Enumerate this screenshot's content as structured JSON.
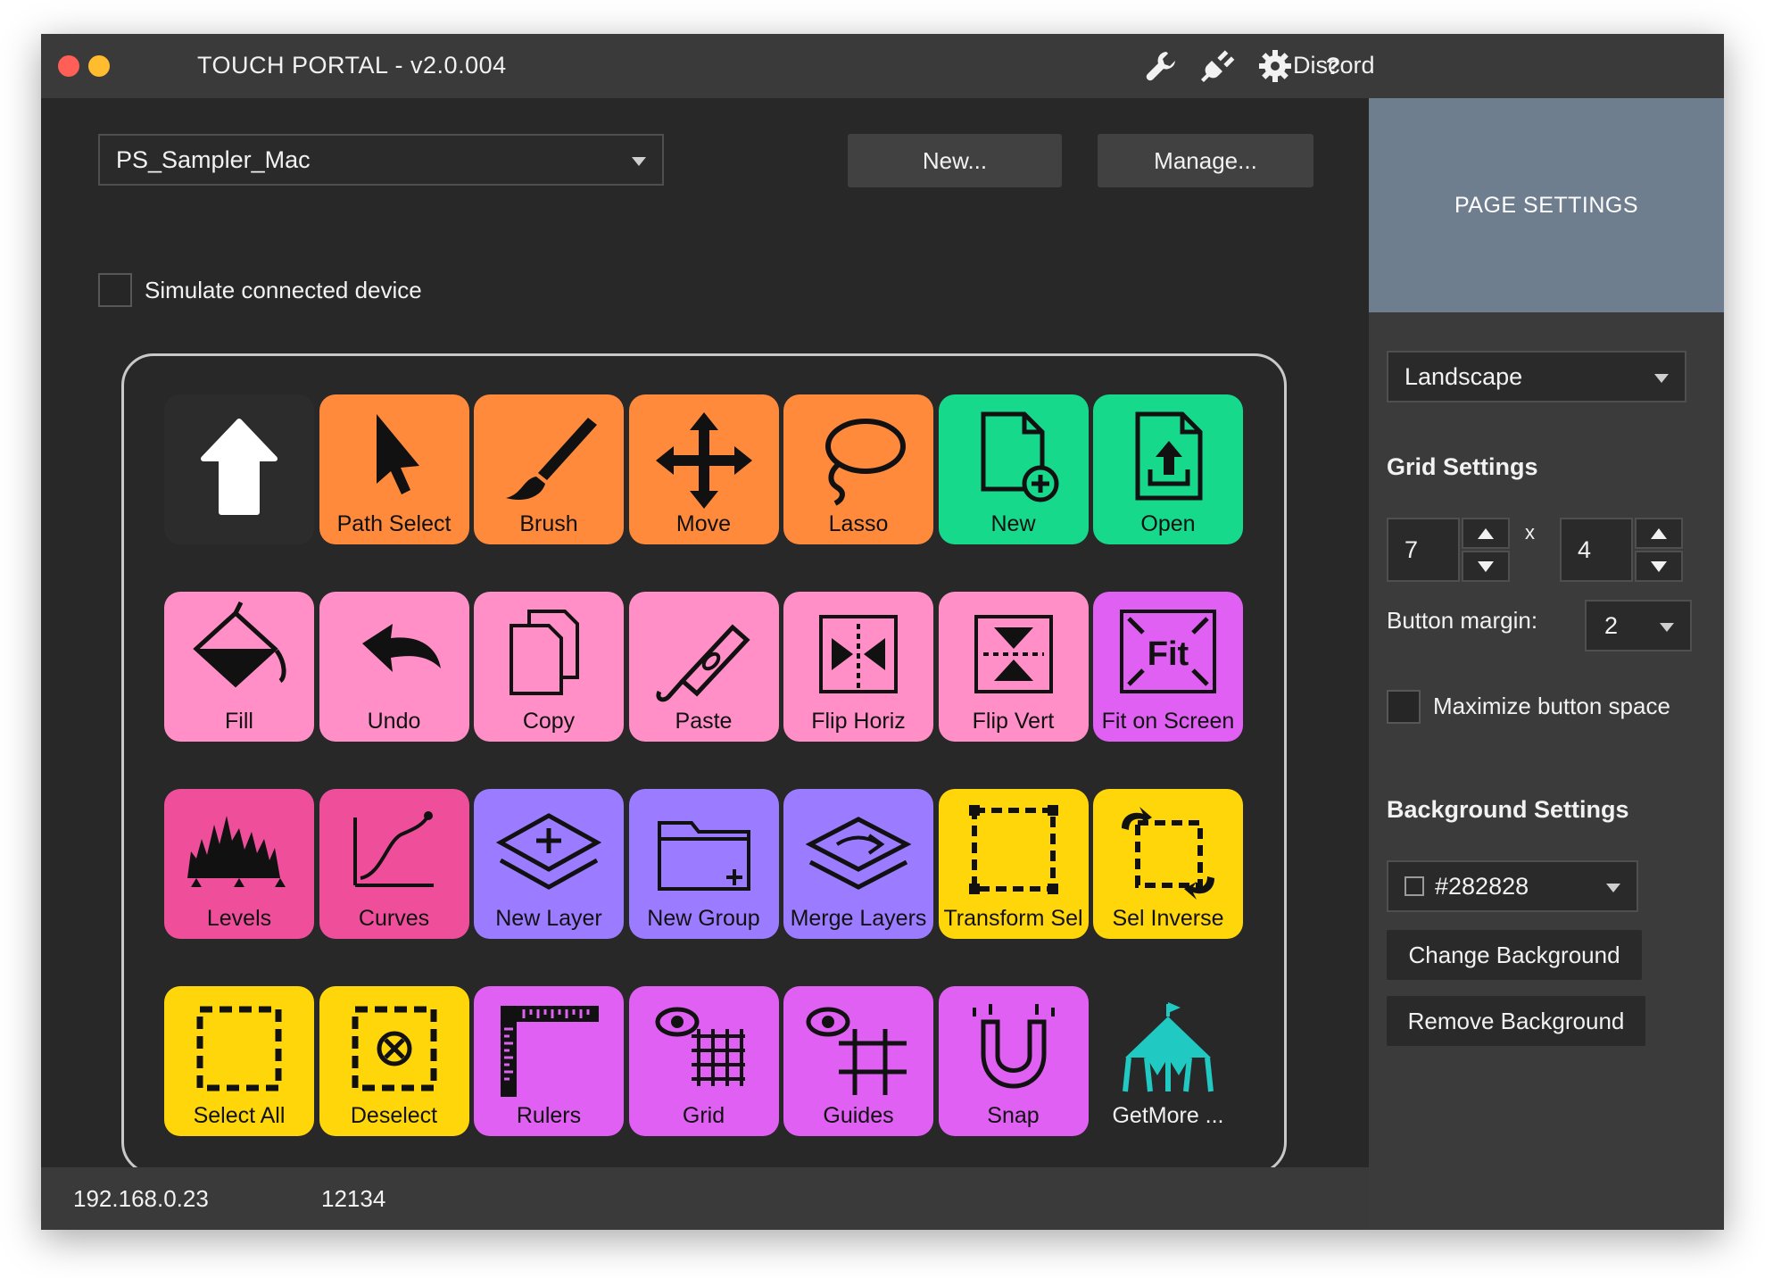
{
  "window": {
    "title": "TOUCH PORTAL - v2.0.004",
    "discord_label": "Discord",
    "icons": [
      "wrench-icon",
      "plug-icon",
      "gear-icon",
      "help-icon"
    ],
    "help_label": "?"
  },
  "toolbar": {
    "page_select_value": "PS_Sampler_Mac",
    "new_label": "New...",
    "manage_label": "Manage..."
  },
  "simulate": {
    "label": "Simulate connected device",
    "checked": false
  },
  "grid": {
    "tiles": [
      {
        "label": "",
        "color": "#2c2c2c",
        "icon": "up-arrow-icon"
      },
      {
        "label": "Path Select",
        "color": "#ff8a3c",
        "icon": "cursor-icon"
      },
      {
        "label": "Brush",
        "color": "#ff8a3c",
        "icon": "brush-icon"
      },
      {
        "label": "Move",
        "color": "#ff8a3c",
        "icon": "move-icon"
      },
      {
        "label": "Lasso",
        "color": "#ff8a3c",
        "icon": "lasso-icon"
      },
      {
        "label": "New",
        "color": "#17d98c",
        "icon": "new-file-icon"
      },
      {
        "label": "Open",
        "color": "#17d98c",
        "icon": "open-file-icon"
      },
      {
        "label": "Fill",
        "color": "#ff8fc6",
        "icon": "fill-bucket-icon"
      },
      {
        "label": "Undo",
        "color": "#ff8fc6",
        "icon": "undo-icon"
      },
      {
        "label": "Copy",
        "color": "#ff8fc6",
        "icon": "copy-icon"
      },
      {
        "label": "Paste",
        "color": "#ff8fc6",
        "icon": "paste-icon"
      },
      {
        "label": "Flip Horiz",
        "color": "#ff8fc6",
        "icon": "flip-horizontal-icon"
      },
      {
        "label": "Flip Vert",
        "color": "#ff8fc6",
        "icon": "flip-vertical-icon"
      },
      {
        "label": "Fit on Screen",
        "color": "#e060f3",
        "icon": "fit-screen-icon"
      },
      {
        "label": "Levels",
        "color": "#ef4f9a",
        "icon": "levels-icon"
      },
      {
        "label": "Curves",
        "color": "#ef4f9a",
        "icon": "curves-icon"
      },
      {
        "label": "New Layer",
        "color": "#9b7bff",
        "icon": "new-layer-icon"
      },
      {
        "label": "New Group",
        "color": "#9b7bff",
        "icon": "new-group-icon"
      },
      {
        "label": "Merge Layers",
        "color": "#9b7bff",
        "icon": "merge-layers-icon"
      },
      {
        "label": "Transform Sel",
        "color": "#ffd60a",
        "icon": "transform-selection-icon"
      },
      {
        "label": "Sel Inverse",
        "color": "#ffd60a",
        "icon": "select-inverse-icon"
      },
      {
        "label": "Select All",
        "color": "#ffd60a",
        "icon": "select-all-icon"
      },
      {
        "label": "Deselect",
        "color": "#ffd60a",
        "icon": "deselect-icon"
      },
      {
        "label": "Rulers",
        "color": "#e060f3",
        "icon": "rulers-icon"
      },
      {
        "label": "Grid",
        "color": "#e060f3",
        "icon": "grid-icon"
      },
      {
        "label": "Guides",
        "color": "#e060f3",
        "icon": "guides-icon"
      },
      {
        "label": "Snap",
        "color": "#e060f3",
        "icon": "snap-magnet-icon"
      },
      {
        "label": "GetMore ...",
        "color": "#282828",
        "icon": "circus-tent-icon"
      }
    ]
  },
  "sidebar": {
    "page_settings_label": "PAGE SETTINGS",
    "orientation_value": "Landscape",
    "grid_settings_title": "Grid Settings",
    "columns_value": "7",
    "rows_value": "4",
    "times_label": "x",
    "button_margin_label": "Button margin:",
    "button_margin_value": "2",
    "maximize_label": "Maximize button space",
    "background_settings_title": "Background Settings",
    "background_color_value": "#282828",
    "change_background_label": "Change Background",
    "remove_background_label": "Remove Background"
  },
  "footer": {
    "ip": "192.168.0.23",
    "port": "12134"
  },
  "colors": {
    "close": "#ff5f57",
    "minimize": "#febc2e",
    "page_settings_bg": "#6f7e8f",
    "panel_bg": "#282828"
  }
}
